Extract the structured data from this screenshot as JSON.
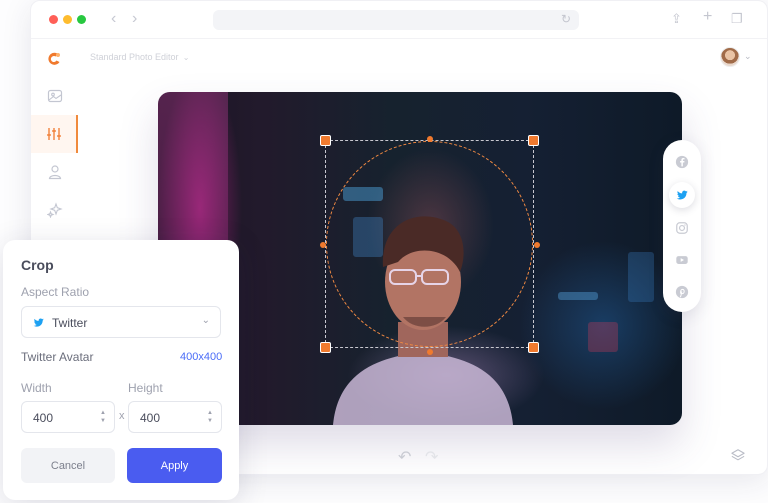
{
  "window": {
    "header": {
      "title": "Standard Photo Editor"
    }
  },
  "sidebar": {
    "items": [
      {
        "name": "image",
        "icon": "image-icon"
      },
      {
        "name": "adjust",
        "icon": "sliders-icon",
        "active": true
      },
      {
        "name": "person",
        "icon": "user-icon"
      },
      {
        "name": "effects",
        "icon": "sparkle-icon"
      }
    ]
  },
  "social": {
    "items": [
      {
        "icon": "facebook-icon"
      },
      {
        "icon": "twitter-icon",
        "active": true
      },
      {
        "icon": "instagram-icon"
      },
      {
        "icon": "youtube-icon"
      },
      {
        "icon": "pinterest-icon"
      }
    ]
  },
  "crop_panel": {
    "title": "Crop",
    "aspect_ratio_label": "Aspect Ratio",
    "aspect_ratio_value": "Twitter",
    "preset_label": "Twitter Avatar",
    "preset_size": "400x400",
    "width_label": "Width",
    "height_label": "Height",
    "width_value": "400",
    "height_value": "400",
    "times_symbol": "x",
    "cancel_label": "Cancel",
    "apply_label": "Apply"
  },
  "colors": {
    "accent": "#f07a2e",
    "primary_button": "#4a5cf0",
    "link": "#4a6cf7",
    "twitter": "#1da1f2"
  }
}
